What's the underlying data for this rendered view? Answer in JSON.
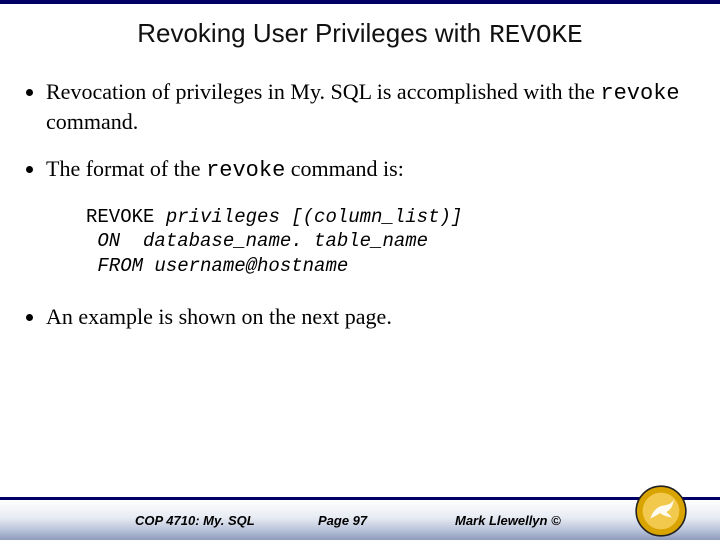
{
  "title": {
    "sans": "Revoking User Privileges with",
    "mono": "REVOKE"
  },
  "bullets": {
    "b1": {
      "pre": "Revocation of privileges in My. SQL is accomplished with the ",
      "code": "revoke",
      "post": " command."
    },
    "b2": {
      "pre": "The format of the ",
      "code": "revoke",
      "post": " command is:"
    },
    "b3": "An example is shown on the next page."
  },
  "code": {
    "line1_kw": "REVOKE",
    "line1_rest": " privileges [(column_list)]",
    "line2_kw": " ON",
    "line2_rest": "  database_name. table_name",
    "line3_kw": " FROM",
    "line3_rest": " username@hostname"
  },
  "footer": {
    "left": "COP 4710: My. SQL",
    "center": "Page 97",
    "right": "Mark Llewellyn ©"
  }
}
